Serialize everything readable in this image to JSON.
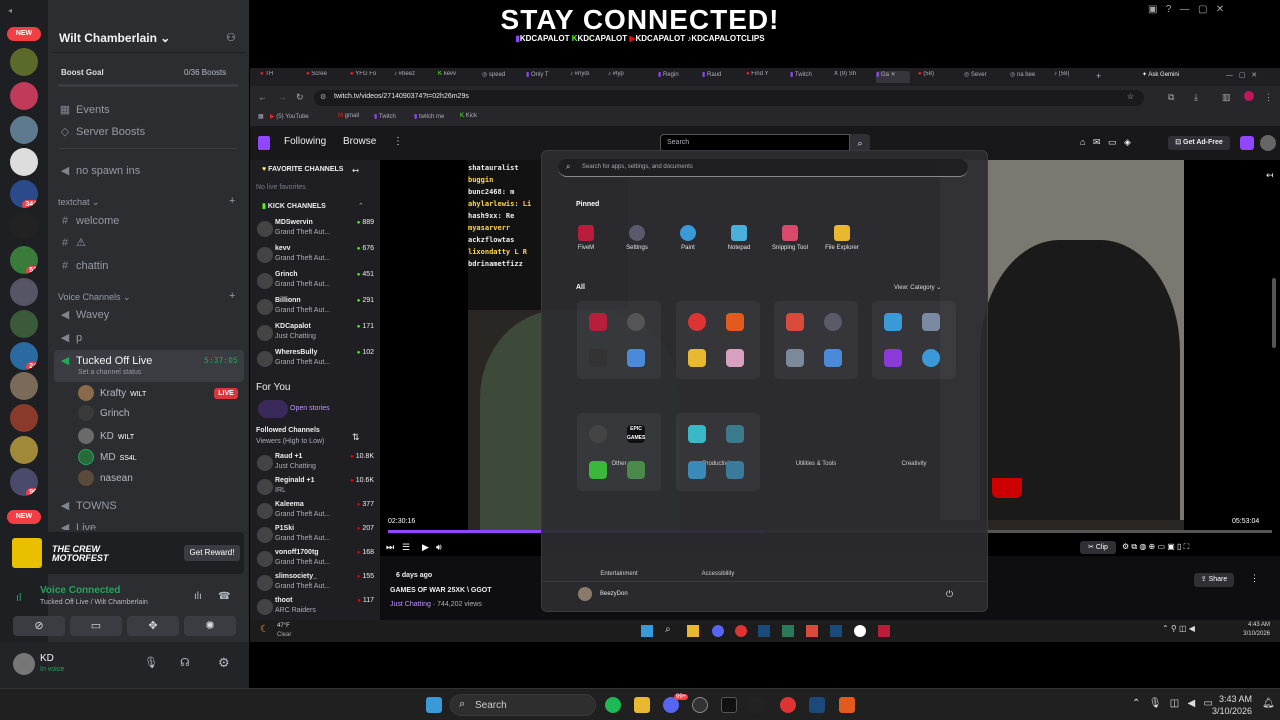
{
  "overlay": {
    "banner": "STAY CONNECTED!",
    "socials": [
      "KDCAPALOT",
      "KDCAPALOT",
      "KDCAPALOT",
      "KDCAPALOTCLIPS"
    ]
  },
  "discord": {
    "server_badges": [
      "NEW",
      "344",
      "51",
      "24",
      "96",
      "NEW"
    ],
    "guild_name": "Wilt Chamberlain",
    "boost_goal": {
      "label": "Boost Goal",
      "value": "0/36 Boosts"
    },
    "top_items": [
      "Events",
      "Server Boosts"
    ],
    "channels_a": [
      "no spawn ins"
    ],
    "cat_text": "textchat",
    "text_channels": [
      "welcome",
      "⚠",
      "chattin"
    ],
    "cat_voice": "Voice Channels",
    "voice_channels": [
      "Wavey",
      "p"
    ],
    "active_vc": {
      "name": "Tucked Off Live",
      "timer": "5:37:05",
      "status": "Set a channel status"
    },
    "vc_users": [
      {
        "name": "Krafty",
        "tag": "WILT",
        "live": "LIVE"
      },
      {
        "name": "Grinch"
      },
      {
        "name": "KD",
        "tag": "WILT"
      },
      {
        "name": "MD",
        "tag": "SS4L"
      },
      {
        "name": "nasean"
      }
    ],
    "towns": "TOWNS",
    "live_label": "Live",
    "promo": {
      "title": "THE CREW MOTORFEST",
      "button": "Get Reward!"
    },
    "voice_connected": {
      "title": "Voice Connected",
      "sub": "Tucked Off Live / Wilt Chamberlain"
    },
    "user": {
      "name": "KD",
      "status": "In voice"
    }
  },
  "browser": {
    "tabs": [
      "TH",
      "Scree",
      "YFG Fo",
      "#beez",
      "kevv",
      "speed",
      "Only T",
      "#nydi",
      "#lyp",
      "Regin",
      "Raud",
      "Find Y",
      "Twitch",
      "(9) Sh",
      "Ga",
      "(58)",
      "Sever",
      "na bee",
      "(58)"
    ],
    "ask_gemini": "Ask Gemini",
    "url": "twitch.tv/videos/2714090374?t=02h26m29s",
    "bookmarks": [
      "(5) YouTube",
      "gmail",
      "Twitch",
      "twitch me",
      "Kick"
    ]
  },
  "twitch": {
    "nav": [
      "Following",
      "Browse"
    ],
    "search_placeholder": "Search",
    "get_ad_free": "Get Ad-Free",
    "fav_header": "FAVORITE CHANNELS",
    "no_favs": "No live favorites",
    "kick_header": "KICK CHANNELS",
    "kick_channels": [
      {
        "name": "MDSwervin",
        "game": "Grand Theft Aut...",
        "viewers": "889"
      },
      {
        "name": "kevv",
        "game": "Grand Theft Aut...",
        "viewers": "676"
      },
      {
        "name": "Grinch",
        "game": "Grand Theft Aut...",
        "viewers": "451"
      },
      {
        "name": "Billionn",
        "game": "Grand Theft Aut...",
        "viewers": "291"
      },
      {
        "name": "KDCapalot",
        "game": "Just Chatting",
        "viewers": "171"
      },
      {
        "name": "WheresBully",
        "game": "Grand Theft Aut...",
        "viewers": "102"
      }
    ],
    "for_you": "For You",
    "open_stories": "Open stories",
    "followed_header": "Followed Channels",
    "followed_sort": "Viewers (High to Low)",
    "followed": [
      {
        "name": "Raud +1",
        "game": "Just Chatting",
        "viewers": "10.8K"
      },
      {
        "name": "Reginald +1",
        "game": "IRL",
        "viewers": "10.6K"
      },
      {
        "name": "Kaleema",
        "game": "Grand Theft Aut...",
        "viewers": "377"
      },
      {
        "name": "P1Ski",
        "game": "Grand Theft Aut...",
        "viewers": "207"
      },
      {
        "name": "vonoff1700tg",
        "game": "Grand Theft Aut...",
        "viewers": "168"
      },
      {
        "name": "slimsociety_",
        "game": "Grand Theft Aut...",
        "viewers": "155"
      },
      {
        "name": "thoot",
        "game": "ARC Raiders",
        "viewers": "117"
      }
    ],
    "chat_overlay": [
      "shatauralist",
      "buggin",
      "bunc2468: m",
      "ahylarlewis: Li",
      "hash9xx: Re",
      "myasarverr",
      "ackzflowtas",
      "lixondatty  L R",
      "bdrinametfizz"
    ],
    "time_current": "02:30:16",
    "time_total": "05:53:04",
    "clip": "Clip",
    "share": "Share",
    "video_age": "6 days ago",
    "video_title": "GAMES OF WAR 25XK \\ GGOT",
    "video_category": "Just Chatting",
    "video_views": "· 744,202 views",
    "progress": 0.425
  },
  "startmenu": {
    "search_placeholder": "Search for apps, settings, and documents",
    "pinned_label": "Pinned",
    "pinned": [
      "FiveM",
      "Settings",
      "Paint",
      "Notepad",
      "Snipping Tool",
      "File Explorer"
    ],
    "all_label": "All",
    "view_label": "View: Category",
    "groups": [
      "Other",
      "Productivity",
      "Utilities & Tools",
      "Creativity",
      "Entertainment",
      "Accessibility"
    ],
    "user": "BeezyDon",
    "epic": "EPIC GAMES"
  },
  "inner_taskbar": {
    "weather_temp": "47°F",
    "weather_cond": "Clear",
    "time": "4:43 AM",
    "date": "3/10/2026"
  },
  "taskbar": {
    "search": "Search",
    "time": "3:43 AM",
    "date": "3/10/2026",
    "badge": "99+"
  },
  "colors": {
    "discord_bg": "#2b2d31",
    "twitch_purple": "#9147ff",
    "live_red": "#eb0400",
    "kick_green": "#53fc18",
    "voice_green": "#23a55a"
  }
}
